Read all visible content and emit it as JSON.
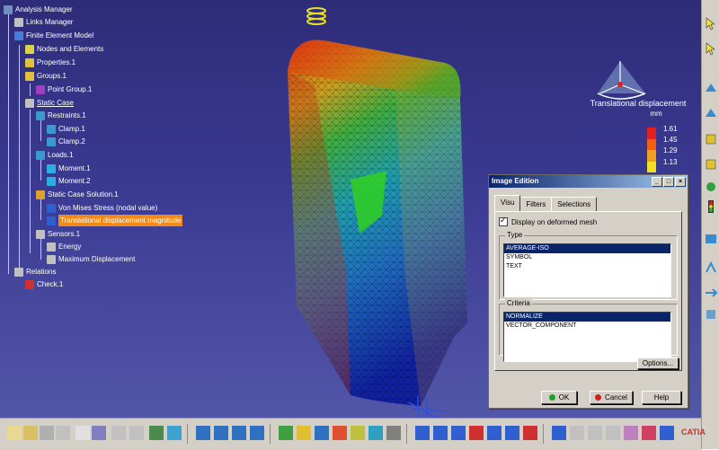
{
  "tree": {
    "items": [
      {
        "label": "Analysis Manager",
        "icon": "analysis-manager-icon",
        "color": "#6f8fbf"
      },
      {
        "label": "Links Manager",
        "icon": "links-manager-icon",
        "color": "#c0c0c0"
      },
      {
        "label": "Finite Element Model",
        "icon": "fem-icon",
        "color": "#4a7bd6"
      },
      {
        "label": "Nodes and Elements",
        "icon": "nodes-icon",
        "color": "#d9d14a"
      },
      {
        "label": "Properties.1",
        "icon": "properties-icon",
        "color": "#e0c040"
      },
      {
        "label": "Groups.1",
        "icon": "groups-icon",
        "color": "#e0c040"
      },
      {
        "label": "Point Group.1",
        "icon": "point-group-icon",
        "color": "#a040c0"
      },
      {
        "label": "Static Case",
        "icon": "static-case-icon",
        "color": "#c0c0c0"
      },
      {
        "label": "Restraints.1",
        "icon": "restraints-icon",
        "color": "#3a9ad0"
      },
      {
        "label": "Clamp.1",
        "icon": "clamp-icon",
        "color": "#3a9ad0"
      },
      {
        "label": "Clamp.2",
        "icon": "clamp-icon",
        "color": "#3a9ad0"
      },
      {
        "label": "Loads.1",
        "icon": "loads-icon",
        "color": "#3a9ad0"
      },
      {
        "label": "Moment.1",
        "icon": "moment-icon",
        "color": "#2ab0e0"
      },
      {
        "label": "Moment.2",
        "icon": "moment-icon",
        "color": "#2ab0e0"
      },
      {
        "label": "Static Case Solution.1",
        "icon": "solution-icon",
        "color": "#e0a030"
      },
      {
        "label": "Von Mises Stress (nodal value)",
        "icon": "image-icon",
        "color": "#3060d0"
      },
      {
        "label": "Translational displacement magnitude",
        "icon": "image-icon",
        "color": "#3060d0"
      },
      {
        "label": "Sensors.1",
        "icon": "sensors-icon",
        "color": "#c0c0c0"
      },
      {
        "label": "Energy",
        "icon": "sensor-icon",
        "color": "#c0c0c0"
      },
      {
        "label": "Maximum Displacement",
        "icon": "sensor-icon",
        "color": "#c0c0c0"
      },
      {
        "label": "Relations",
        "icon": "relations-icon",
        "color": "#c0c0c0"
      },
      {
        "label": "Check.1",
        "icon": "check-icon",
        "color": "#d03030"
      }
    ]
  },
  "legend": {
    "title": "Translational displacement",
    "unit": "mm",
    "values": [
      "1.61",
      "1.45",
      "1.29",
      "1.13"
    ],
    "colors": [
      "#e02020",
      "#f06010",
      "#f0a020",
      "#f0e020"
    ]
  },
  "dialog": {
    "title": "Image Edition",
    "tabs": [
      "Visu",
      "Filters",
      "Selections"
    ],
    "display_checkbox": "Display on deformed mesh",
    "type_label": "Type",
    "type_options": [
      "AVERAGE-ISO",
      "SYMBOL",
      "TEXT"
    ],
    "criteria_label": "Criteria",
    "criteria_options": [
      "NORMALIZE",
      "VECTOR_COMPONENT"
    ],
    "options_label": "Options...",
    "ok_label": "OK",
    "cancel_label": "Cancel",
    "help_label": "Help"
  },
  "brand": "CATIA",
  "colors": {
    "accent": "#0a246a",
    "selection": "#f28a1a"
  }
}
